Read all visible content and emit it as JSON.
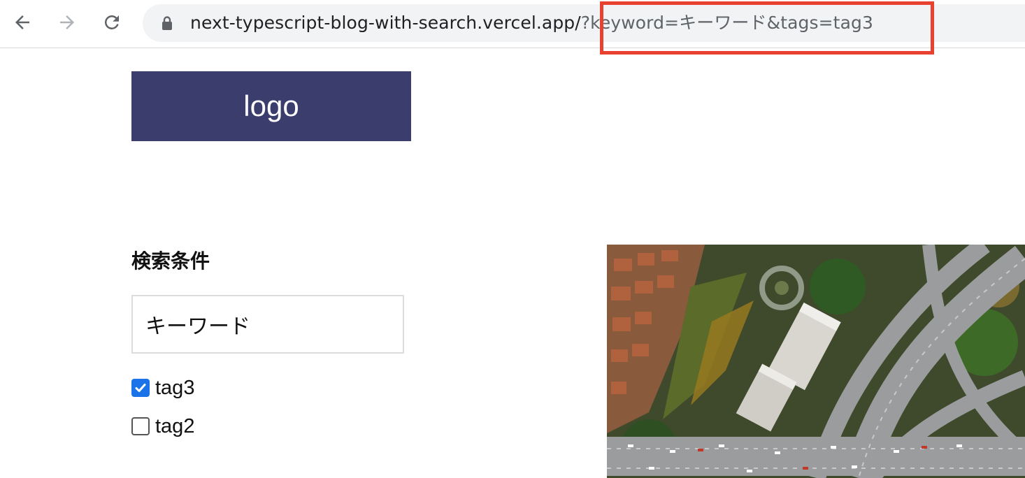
{
  "browser": {
    "url_host": "next-typescript-blog-with-search.vercel.app/",
    "url_query": "?keyword=キーワード&tags=tag3",
    "back_icon": "arrow-left-icon",
    "forward_icon": "arrow-right-icon",
    "reload_icon": "reload-icon",
    "lock_icon": "lock-icon",
    "highlight_color": "#e8412f"
  },
  "header": {
    "logo_text": "logo",
    "logo_bg": "#3b3d6c"
  },
  "search": {
    "heading": "検索条件",
    "keyword_value": "キーワード",
    "tags": [
      {
        "label": "tag3",
        "checked": true
      },
      {
        "label": "tag2",
        "checked": false
      }
    ],
    "checkbox_accent": "#1a73e8"
  },
  "hero": {
    "image_icon": "aerial-city-highway-photo"
  }
}
